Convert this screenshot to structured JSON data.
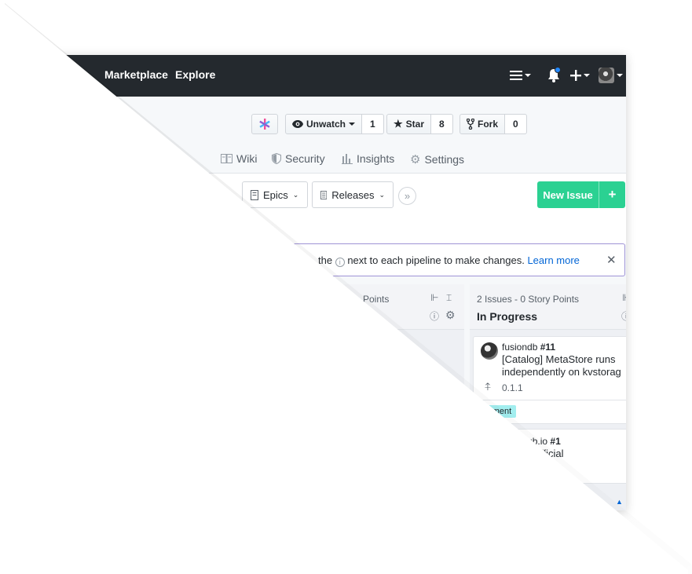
{
  "nav": {
    "links": [
      "Marketplace",
      "Explore"
    ],
    "icons": [
      "menu-icon",
      "bell-icon",
      "plus-icon",
      "avatar"
    ],
    "notification_color": "#2188ff"
  },
  "repo": {
    "watch_label": "Unwatch",
    "watch_count": "1",
    "star_label": "Star",
    "star_count": "8",
    "fork_label": "Fork",
    "fork_count": "0"
  },
  "tabs": [
    "Wiki",
    "Security",
    "Insights",
    "Settings"
  ],
  "toolbar": {
    "epics_label": "Epics",
    "releases_label": "Releases",
    "more_label": "»",
    "new_issue_label": "New Issue",
    "new_issue_plus": "+",
    "accent": "#2bd192"
  },
  "banner": {
    "text": "the",
    "text_after": "next to each pipeline to make changes.",
    "link": "Learn more",
    "close": "✕"
  },
  "pipelines": [
    {
      "meta": "Points",
      "name": ""
    },
    {
      "meta": "2 Issues - 0 Story Points",
      "name": "In Progress"
    }
  ],
  "cards": [
    {
      "repo": "fusiondb",
      "number": "#11",
      "title_line1": "[Catalog] MetaStore runs",
      "title_line2": "independently on kvstorag",
      "release": "0.1.1",
      "label": "ncement"
    },
    {
      "repo": "ib.github.io",
      "number": "#1",
      "title_line1": "uild an official"
    }
  ]
}
